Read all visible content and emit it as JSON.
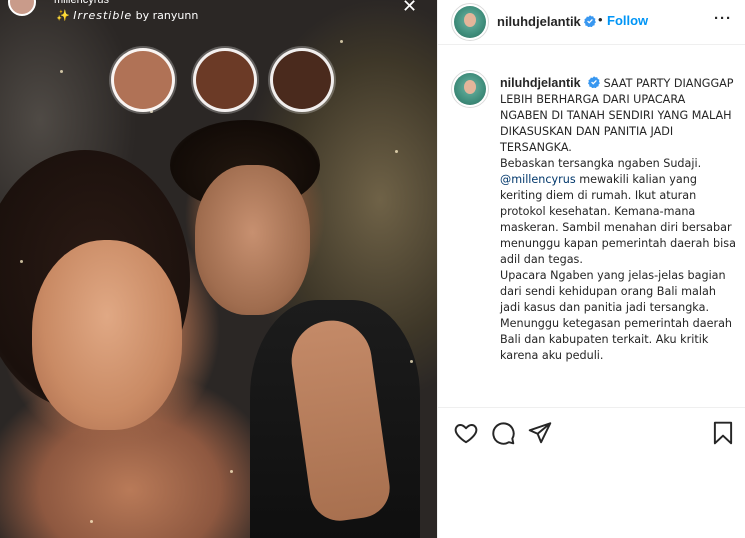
{
  "story": {
    "username": "millencyrus",
    "filter_prefix": "✨",
    "filter_name": "Irrestible",
    "filter_by": "by ranyunn",
    "close_glyph": "✕"
  },
  "post": {
    "header": {
      "username": "niluhdjelantik",
      "separator": "•",
      "follow_label": "Follow",
      "more_label": "···"
    },
    "caption": {
      "username": "niluhdjelantik",
      "lead": "SAAT PARTY DIANGGAP LEBIH BERHARGA DARI UPACARA NGABEN DI TANAH SENDIRI YANG MALAH DIKASUSKAN DAN PANITIA JADI TERSANGKA.",
      "p1": "Bebaskan tersangka ngaben Sudaji.",
      "mention": "@millencyrus",
      "p2_rest": " mewakili kalian yang keriting diem di rumah. Ikut aturan protokol kesehatan. Kemana-mana maskeran. Sambil menahan diri bersabar menunggu kapan pemerintah daerah bisa adil dan tegas.",
      "p3": "Upacara Ngaben yang jelas-jelas bagian dari sendi kehidupan orang Bali malah jadi kasus dan panitia jadi tersangka.",
      "p4": "Menunggu ketegasan pemerintah daerah Bali dan kabupaten terkait. Aku kritik karena aku peduli."
    }
  },
  "icons": {
    "verified": "verified-badge-icon",
    "like": "heart-icon",
    "comment": "comment-icon",
    "share": "paper-plane-icon",
    "save": "bookmark-icon",
    "close": "close-icon"
  },
  "colors": {
    "follow": "#0095f6",
    "verified": "#3897f0",
    "mention": "#00376b",
    "text": "#262626",
    "divider": "#efefef"
  }
}
